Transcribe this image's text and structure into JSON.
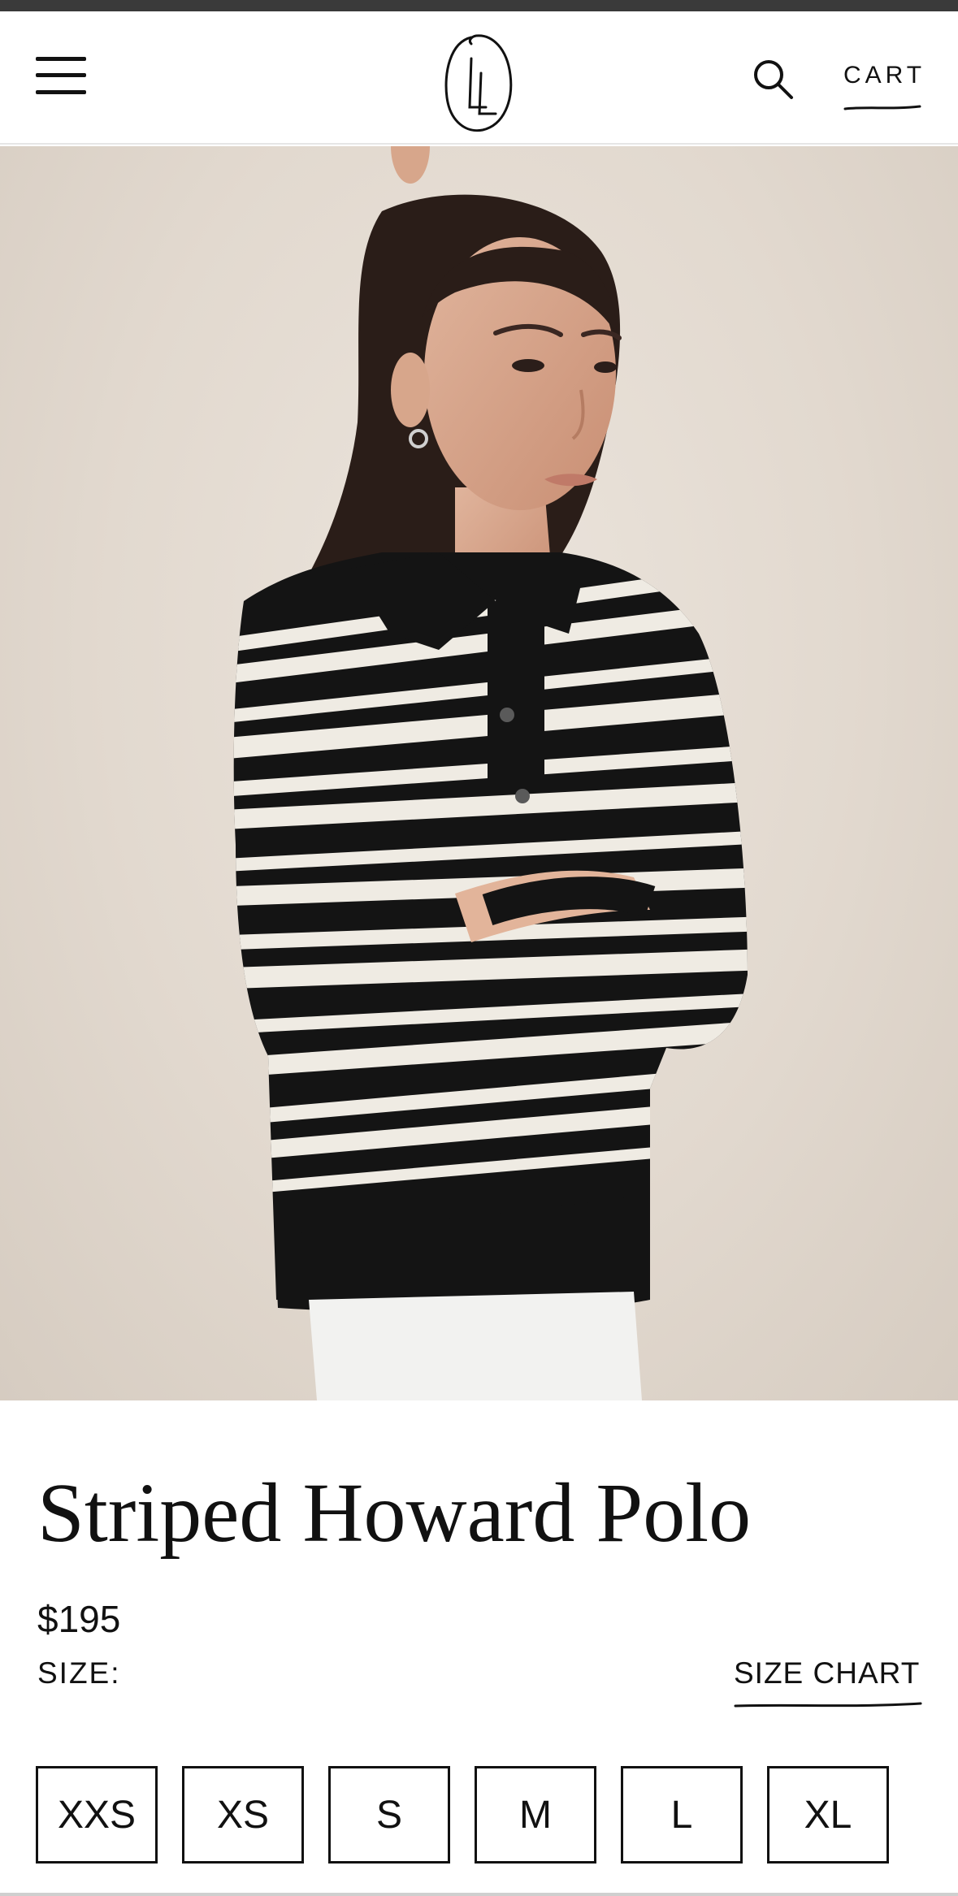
{
  "header": {
    "logo_text": "LL",
    "cart_label": "CART",
    "menu_icon": "hamburger-menu-icon",
    "search_icon": "search-icon"
  },
  "gallery": {
    "image_count": 9,
    "active_index": 0
  },
  "product": {
    "title": "Striped Howard Polo",
    "price": "$195",
    "size_label": "SIZE:",
    "size_chart_label": "SIZE CHART",
    "sizes": [
      "XXS",
      "XS",
      "S",
      "M",
      "L",
      "XL"
    ]
  },
  "colors": {
    "text": "#111111",
    "background": "#ffffff",
    "hero_background": "#e4dbd1"
  }
}
